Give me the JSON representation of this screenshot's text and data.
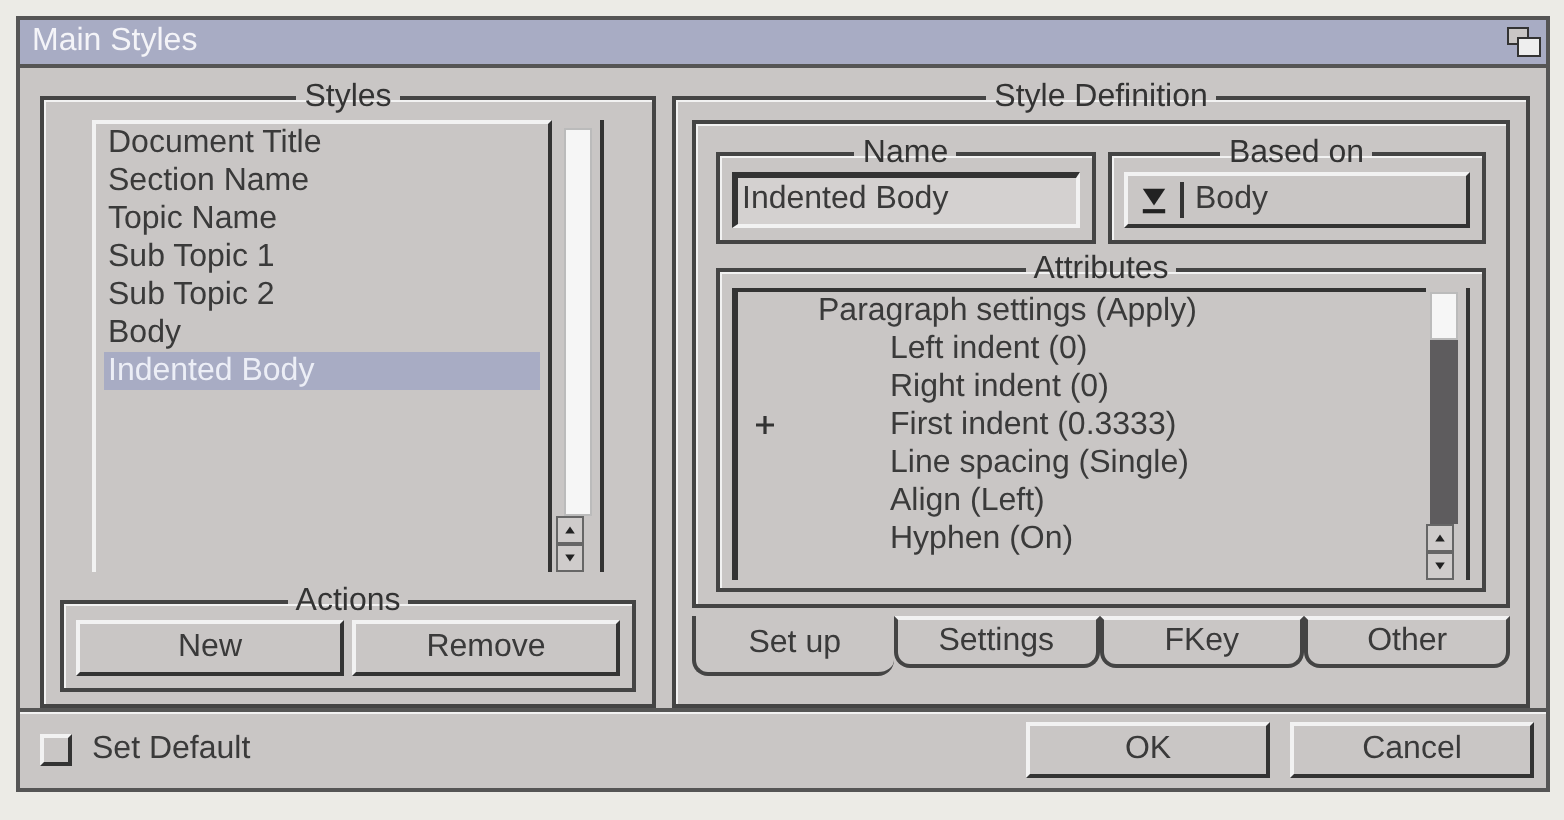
{
  "window": {
    "title": "Main Styles"
  },
  "styles": {
    "title": "Styles",
    "items": [
      {
        "label": "Document Title",
        "selected": false
      },
      {
        "label": "Section Name",
        "selected": false
      },
      {
        "label": "Topic Name",
        "selected": false
      },
      {
        "label": "Sub Topic 1",
        "selected": false
      },
      {
        "label": "Sub Topic 2",
        "selected": false
      },
      {
        "label": "Body",
        "selected": false
      },
      {
        "label": "Indented Body",
        "selected": true
      }
    ]
  },
  "actions": {
    "title": "Actions",
    "buttons": [
      "New",
      "Remove"
    ]
  },
  "style_definition": {
    "title": "Style Definition",
    "name": {
      "title": "Name",
      "value": "Indented Body"
    },
    "based_on": {
      "title": "Based on",
      "value": "Body"
    },
    "attributes": {
      "title": "Attributes",
      "items": [
        {
          "label": "Paragraph settings (Apply)",
          "marked": false,
          "children": [
            {
              "label": "Left indent (0)",
              "marked": false
            },
            {
              "label": "Right indent (0)",
              "marked": false
            },
            {
              "label": "First indent (0.3333)",
              "marked": true
            },
            {
              "label": "Line spacing (Single)",
              "marked": false
            },
            {
              "label": "Align (Left)",
              "marked": false
            },
            {
              "label": "Hyphen (On)",
              "marked": false
            }
          ]
        }
      ]
    },
    "tabs": [
      {
        "label": "Set up",
        "selected": true
      },
      {
        "label": "Settings",
        "selected": false
      },
      {
        "label": "FKey",
        "selected": false
      },
      {
        "label": "Other",
        "selected": false
      }
    ]
  },
  "set_default": {
    "label": "Set Default",
    "checked": false
  },
  "buttons": [
    "OK",
    "Cancel"
  ]
}
